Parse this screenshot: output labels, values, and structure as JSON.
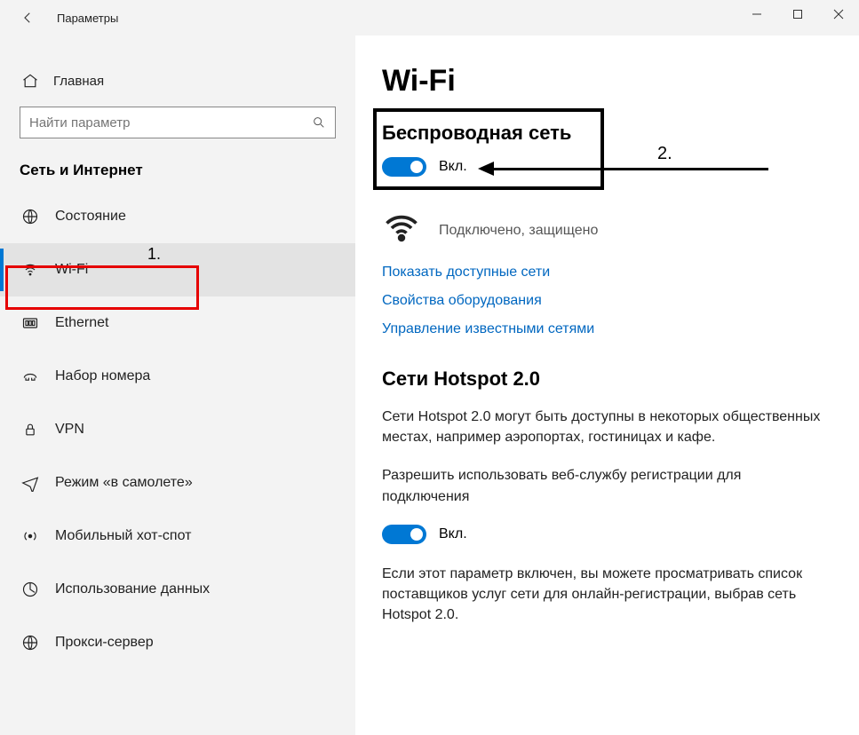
{
  "titlebar": {
    "title": "Параметры"
  },
  "sidebar": {
    "home_label": "Главная",
    "search_placeholder": "Найти параметр",
    "category_title": "Сеть и Интернет",
    "items": [
      {
        "label": "Состояние"
      },
      {
        "label": "Wi-Fi"
      },
      {
        "label": "Ethernet"
      },
      {
        "label": "Набор номера"
      },
      {
        "label": "VPN"
      },
      {
        "label": "Режим «в самолете»"
      },
      {
        "label": "Мобильный хот-спот"
      },
      {
        "label": "Использование данных"
      },
      {
        "label": "Прокси-сервер"
      }
    ]
  },
  "content": {
    "page_title": "Wi-Fi",
    "wireless_section_title": "Беспроводная сеть",
    "wireless_toggle_label": "Вкл.",
    "status_text": "Подключено, защищено",
    "link_show_networks": "Показать доступные сети",
    "link_hw_props": "Свойства оборудования",
    "link_manage": "Управление известными сетями",
    "hotspot_title": "Сети Hotspot 2.0",
    "hotspot_desc": "Сети Hotspot 2.0 могут быть доступны в некоторых общественных местах, например аэропортах, гостиницах и кафе.",
    "hotspot_allow": "Разрешить использовать веб-службу регистрации для подключения",
    "hotspot_toggle_label": "Вкл.",
    "hotspot_info": "Если этот параметр включен, вы можете просматривать список поставщиков услуг сети для онлайн-регистрации, выбрав сеть Hotspot 2.0."
  },
  "annotations": {
    "label1": "1.",
    "label2": "2."
  }
}
